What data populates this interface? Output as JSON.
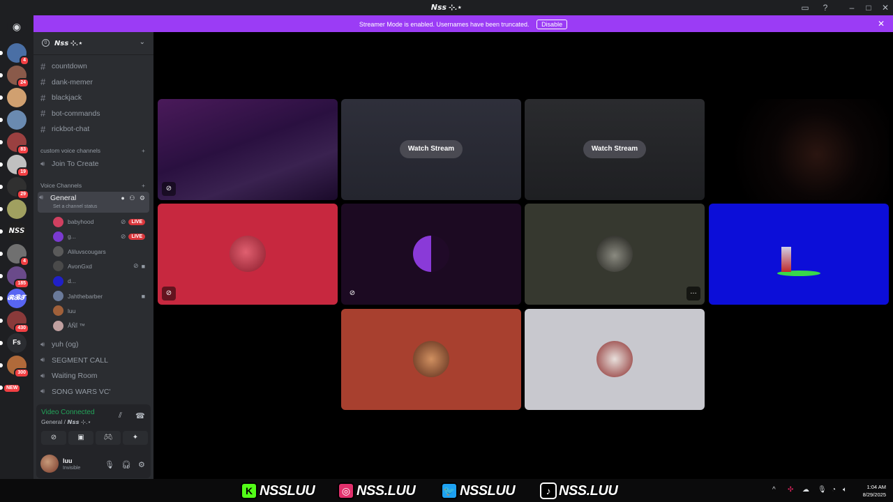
{
  "window": {
    "title": "𝙉𝙨𝙨 ⊹.⋆",
    "controls": [
      "inbox-icon",
      "help-icon",
      "minimize-icon",
      "maximize-icon",
      "close-icon"
    ]
  },
  "banner": {
    "message": "Streamer Mode is enabled. Usernames have been truncated.",
    "button": "Disable"
  },
  "guilds": [
    {
      "badge": "4"
    },
    {
      "badge": "24"
    },
    {
      "badge": ""
    },
    {
      "badge": ""
    },
    {
      "badge": "83"
    },
    {
      "badge": "19"
    },
    {
      "badge": "29"
    },
    {
      "badge": ""
    },
    {
      "label": "𝙉𝙎𝙎"
    },
    {
      "badge": "4"
    },
    {
      "badge": "185"
    },
    {
      "label": "𝓡𝓑𝓣"
    },
    {
      "badge": "430"
    },
    {
      "label": "Fs"
    },
    {
      "badge": "300"
    },
    {
      "badge": "NEW"
    }
  ],
  "server": {
    "name": "𝙉𝙨𝙨 ⊹.⋆",
    "boost": "0"
  },
  "text_channels": [
    "countdown",
    "dank-memer",
    "blackjack",
    "bot-commands",
    "rickbot-chat"
  ],
  "categories": {
    "custom": "custom voice channels",
    "voice": "Voice Channels"
  },
  "join_to_create": "Join To Create",
  "general": {
    "name": "General",
    "status": "Set a channel status"
  },
  "voice_users": [
    {
      "name": "babyhood",
      "live": "LIVE"
    },
    {
      "name": "g...",
      "live": "LIVE"
    },
    {
      "name": "Aliluvscougars",
      "live": ""
    },
    {
      "name": "AvonGxd",
      "live": ""
    },
    {
      "name": "d...",
      "live": ""
    },
    {
      "name": "Jahthebarber",
      "live": ""
    },
    {
      "name": "luu",
      "live": ""
    },
    {
      "name": "ÅÑĪ ™",
      "live": ""
    }
  ],
  "other_voice": [
    "yuh (og)",
    "SEGMENT CALL",
    "Waiting Room",
    "SONG WARS VC'"
  ],
  "voice_panel": {
    "status": "Video Connected",
    "location": "General / 𝙉𝙨𝙨 ⊹.⋆"
  },
  "user": {
    "name": "luu",
    "status": "Invisible"
  },
  "tiles": {
    "watch_label": "Watch Stream"
  },
  "socials": [
    {
      "logo": "K",
      "handle": "NSSLUU",
      "color": "#53fc18"
    },
    {
      "logo": "◎",
      "handle": "NSS.LUU",
      "color": "#e1306c"
    },
    {
      "logo": "🐦",
      "handle": "NSSLUU",
      "color": "#1da1f2"
    },
    {
      "logo": "♪",
      "handle": "NSS.LUU",
      "color": "#000000"
    }
  ],
  "clock": {
    "time": "1:04 AM",
    "date": "8/29/2025"
  },
  "colors": {
    "accent": "#9b3cf5",
    "connected": "#23a55a",
    "live": "#da373c"
  }
}
